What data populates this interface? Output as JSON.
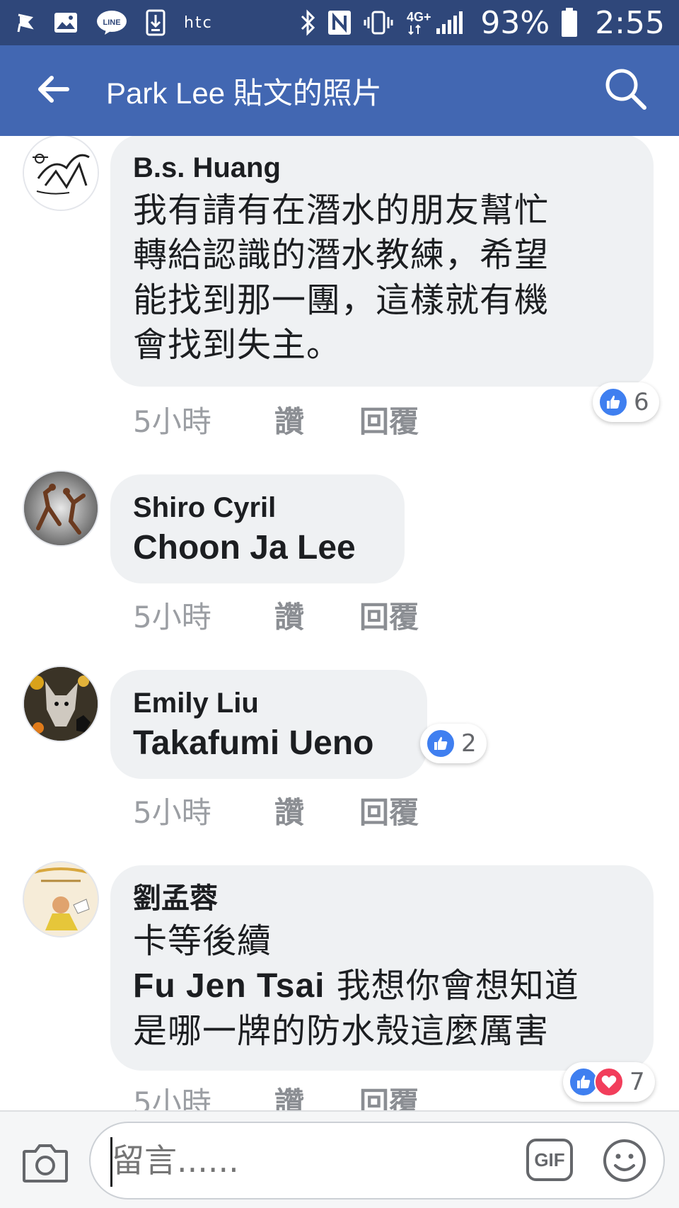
{
  "statusbar": {
    "carrier": "htc",
    "network": "4G+",
    "battery_pct": "93%",
    "time": "2:55"
  },
  "appbar": {
    "title": "Park Lee 貼文的照片"
  },
  "comments": [
    {
      "author": "B.s. Huang",
      "lines": [
        "我有請有在潛水的朋友幫忙",
        "轉給認識的潛水教練，希望",
        "能找到那一團，這樣就有機",
        "會找到失主。"
      ],
      "time": "5小時",
      "like_label": "讚",
      "reply_label": "回覆",
      "reactions": {
        "types": [
          "like"
        ],
        "count": "6"
      }
    },
    {
      "author": "Shiro Cyril",
      "tag": "Choon Ja Lee",
      "time": "5小時",
      "like_label": "讚",
      "reply_label": "回覆"
    },
    {
      "author": "Emily Liu",
      "tag": "Takafumi Ueno",
      "time": "5小時",
      "like_label": "讚",
      "reply_label": "回覆",
      "reactions": {
        "types": [
          "like"
        ],
        "count": "2"
      }
    },
    {
      "author": "劉孟蓉",
      "line1": "卡等後續",
      "tag": "Fu Jen Tsai",
      "line2_rest": " 我想你會想知道",
      "line3": "是哪一牌的防水殼這麼厲害",
      "time": "5小時",
      "like_label": "讚",
      "reply_label": "回覆",
      "reactions": {
        "types": [
          "like",
          "love"
        ],
        "count": "7"
      }
    }
  ],
  "composer": {
    "placeholder": "留言......",
    "gif_label": "GIF"
  },
  "colors": {
    "statusbar": "#2f477a",
    "appbar": "#4267b2",
    "bubble": "#eff1f3",
    "like": "#3f7ff0",
    "love": "#f23e5b"
  },
  "icons": {
    "back": "arrow-left-icon",
    "search": "search-icon",
    "camera": "camera-icon",
    "emoji": "smiley-icon"
  }
}
